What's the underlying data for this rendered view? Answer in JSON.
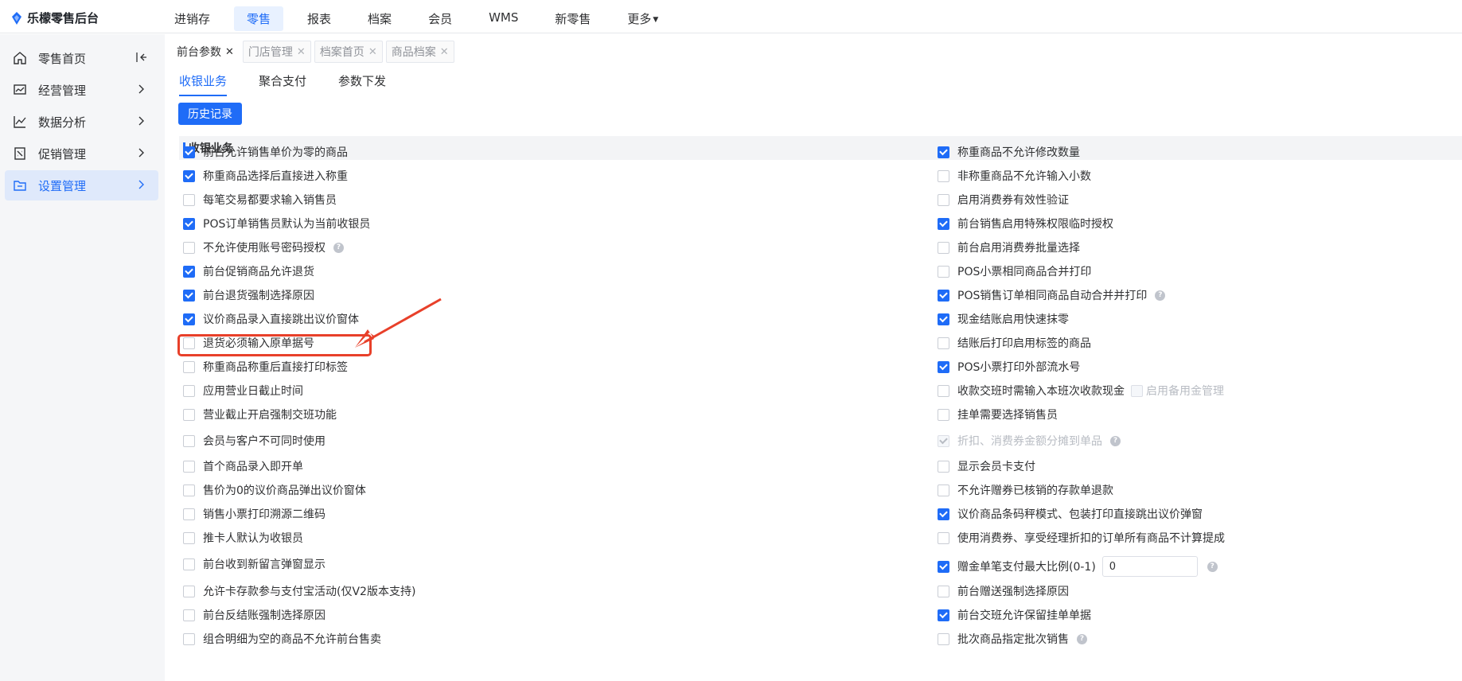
{
  "brand": {
    "name": "乐檬零售后台"
  },
  "topnav": [
    {
      "label": "进销存",
      "active": false
    },
    {
      "label": "零售",
      "active": true
    },
    {
      "label": "报表",
      "active": false
    },
    {
      "label": "档案",
      "active": false
    },
    {
      "label": "会员",
      "active": false
    },
    {
      "label": "WMS",
      "active": false
    },
    {
      "label": "新零售",
      "active": false
    },
    {
      "label": "更多",
      "active": false
    }
  ],
  "sidebar": {
    "items": [
      {
        "label": "零售首页",
        "icon": "home-icon",
        "active": false
      },
      {
        "label": "经营管理",
        "icon": "chart-board-icon",
        "active": false
      },
      {
        "label": "数据分析",
        "icon": "line-chart-icon",
        "active": false
      },
      {
        "label": "促销管理",
        "icon": "promo-icon",
        "active": false
      },
      {
        "label": "设置管理",
        "icon": "folder-icon",
        "active": true
      }
    ]
  },
  "tabs": [
    {
      "label": "前台参数",
      "active": true
    },
    {
      "label": "门店管理",
      "active": false
    },
    {
      "label": "档案首页",
      "active": false
    },
    {
      "label": "商品档案",
      "active": false
    }
  ],
  "subtabs": [
    {
      "label": "收银业务",
      "active": true
    },
    {
      "label": "聚合支付",
      "active": false
    },
    {
      "label": "参数下发",
      "active": false
    }
  ],
  "history_button": "历史记录",
  "section_title": "收银业务",
  "left_options": [
    {
      "label": "前台允许销售单价为零的商品",
      "checked": true
    },
    {
      "label": "称重商品选择后直接进入称重",
      "checked": true
    },
    {
      "label": "每笔交易都要求输入销售员",
      "checked": false
    },
    {
      "label": "POS订单销售员默认为当前收银员",
      "checked": true
    },
    {
      "label": "不允许使用账号密码授权",
      "checked": false,
      "help": true
    },
    {
      "label": "前台促销商品允许退货",
      "checked": true
    },
    {
      "label": "前台退货强制选择原因",
      "checked": true
    },
    {
      "label": "议价商品录入直接跳出议价窗体",
      "checked": true
    },
    {
      "label": "退货必须输入原单据号",
      "checked": false
    },
    {
      "label": "称重商品称重后直接打印标签",
      "checked": false
    },
    {
      "label": "应用营业日截止时间",
      "checked": false
    },
    {
      "label": "营业截止开启强制交班功能",
      "checked": false
    },
    {
      "label": "会员与客户不可同时使用",
      "checked": false
    },
    {
      "label": "首个商品录入即开单",
      "checked": false
    },
    {
      "label": "售价为0的议价商品弹出议价窗体",
      "checked": false
    },
    {
      "label": "销售小票打印溯源二维码",
      "checked": false
    },
    {
      "label": "推卡人默认为收银员",
      "checked": false
    },
    {
      "label": "前台收到新留言弹窗显示",
      "checked": false
    },
    {
      "label": "允许卡存款参与支付宝活动(仅V2版本支持)",
      "checked": false
    },
    {
      "label": "前台反结账强制选择原因",
      "checked": false
    },
    {
      "label": "组合明细为空的商品不允许前台售卖",
      "checked": false
    }
  ],
  "right_options": [
    {
      "label": "称重商品不允许修改数量",
      "checked": true
    },
    {
      "label": "非称重商品不允许输入小数",
      "checked": false
    },
    {
      "label": "启用消费券有效性验证",
      "checked": false
    },
    {
      "label": "前台销售启用特殊权限临时授权",
      "checked": true
    },
    {
      "label": "前台启用消费券批量选择",
      "checked": false
    },
    {
      "label": "POS小票相同商品合并打印",
      "checked": false
    },
    {
      "label": "POS销售订单相同商品自动合并并打印",
      "checked": true,
      "help": true
    },
    {
      "label": "现金结账启用快速抹零",
      "checked": true
    },
    {
      "label": "结账后打印启用标签的商品",
      "checked": false
    },
    {
      "label": "POS小票打印外部流水号",
      "checked": true
    },
    {
      "label": "收款交班时需输入本班次收款现金",
      "checked": false,
      "sub_label": "启用备用金管理"
    },
    {
      "label": "挂单需要选择销售员",
      "checked": false
    },
    {
      "label": "折扣、消费券金额分摊到单品",
      "checked": true,
      "disabled": true,
      "help": true
    },
    {
      "label": "显示会员卡支付",
      "checked": false
    },
    {
      "label": "不允许赠券已核销的存款单退款",
      "checked": false
    },
    {
      "label": "议价商品条码秤模式、包装打印直接跳出议价弹窗",
      "checked": true
    },
    {
      "label": "使用消费券、享受经理折扣的订单所有商品不计算提成",
      "checked": false
    },
    {
      "label": "赠金单笔支付最大比例(0-1)",
      "checked": true,
      "input_value": "0",
      "help": true
    },
    {
      "label": "前台赠送强制选择原因",
      "checked": false
    },
    {
      "label": "前台交班允许保留挂单单据",
      "checked": true
    },
    {
      "label": "批次商品指定批次销售",
      "checked": false,
      "help": true
    }
  ],
  "colors": {
    "accent": "#1f6cf7",
    "annotation": "#e8402a"
  }
}
